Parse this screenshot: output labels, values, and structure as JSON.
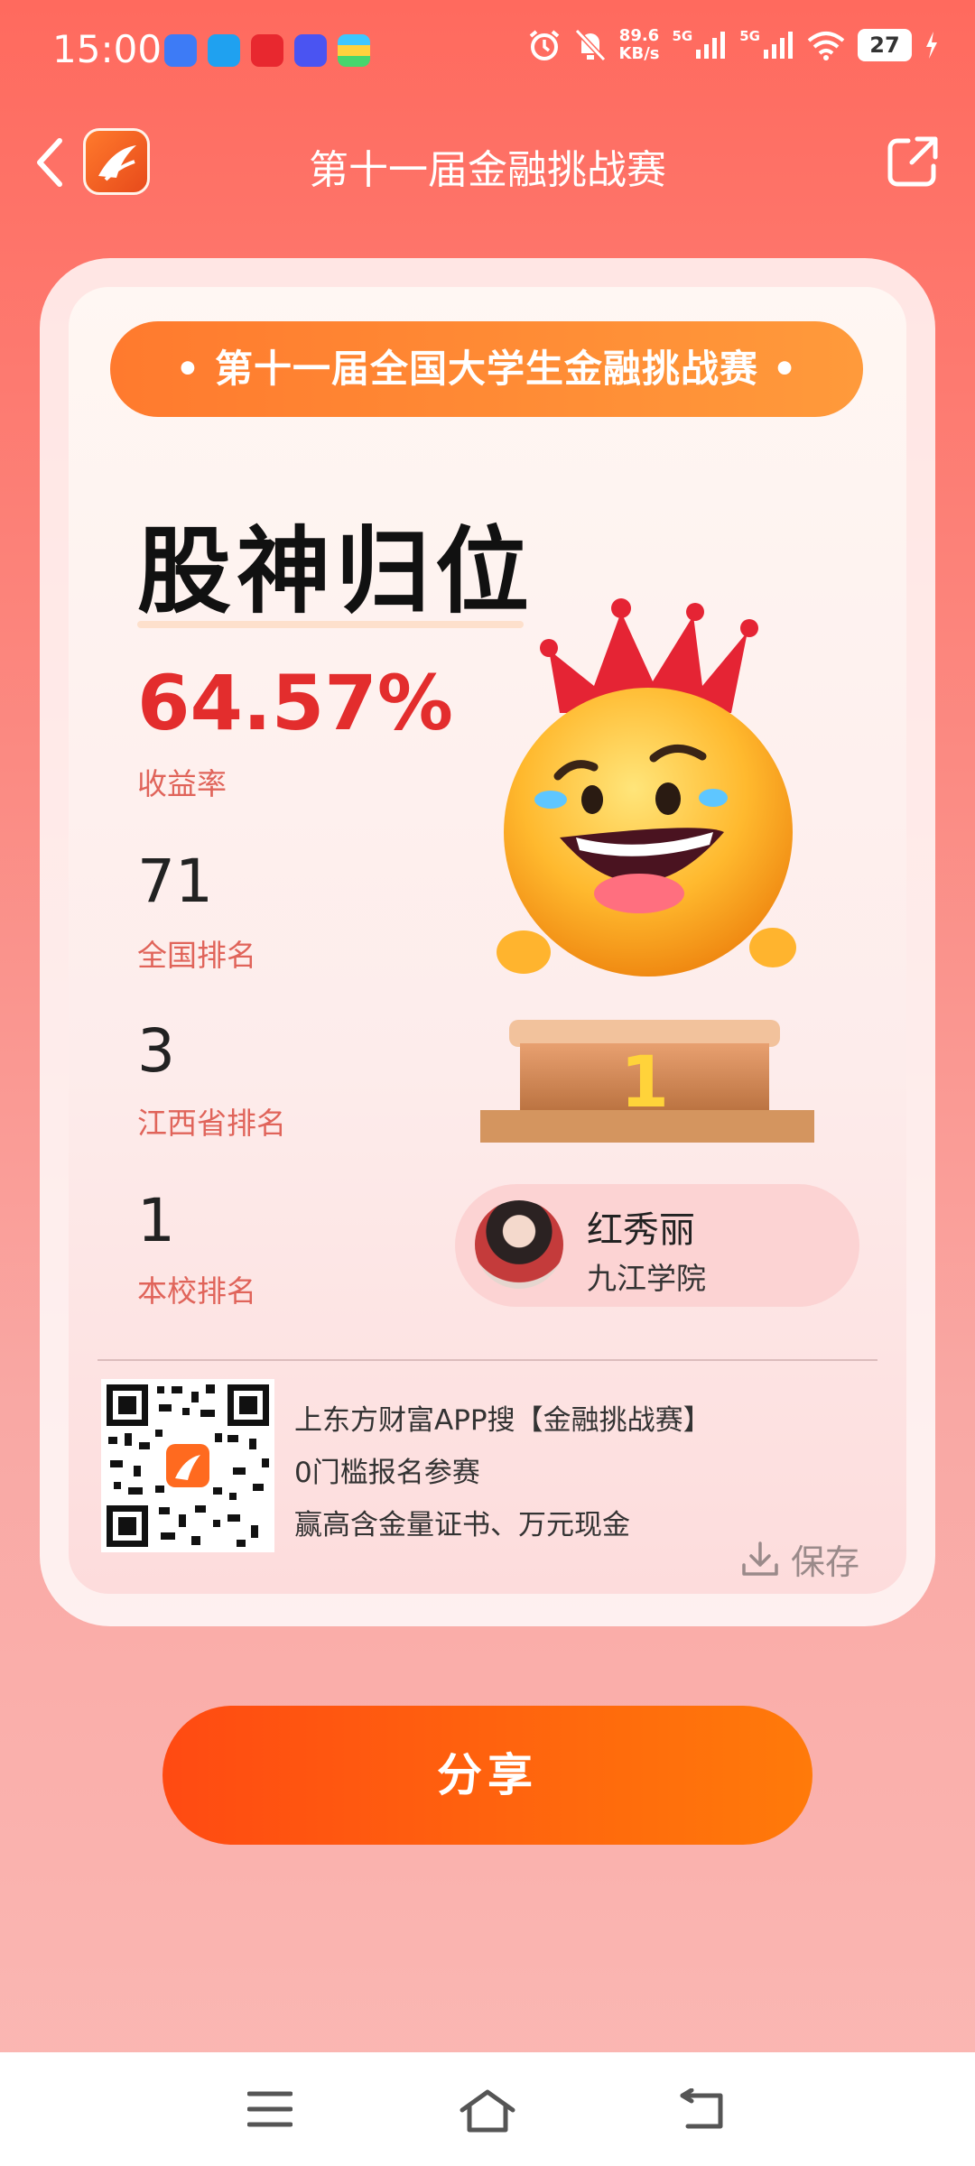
{
  "status_bar": {
    "time": "15:00",
    "net_speed_value": "89.6",
    "net_speed_unit": "KB/s",
    "sim1_label": "5G",
    "sim2_label": "5G",
    "battery": "27"
  },
  "header": {
    "title": "第十一届金融挑战赛"
  },
  "card": {
    "banner": "• 第十一届全国大学生金融挑战赛 •",
    "achievement": "股神归位",
    "stats": {
      "yield_value": "64.57%",
      "yield_label": "收益率",
      "national_rank_value": "71",
      "national_rank_label": "全国排名",
      "province_rank_value": "3",
      "province_rank_label": "江西省排名",
      "school_rank_value": "1",
      "school_rank_label": "本校排名"
    },
    "trophy_rank": "1",
    "user": {
      "name": "红秀丽",
      "school": "九江学院"
    },
    "promo": {
      "line1": "上东方财富APP搜【金融挑战赛】",
      "line2": "0门槛报名参赛",
      "line3": "赢高含金量证书、万元现金"
    },
    "save_label": "保存"
  },
  "share_button": "分享"
}
